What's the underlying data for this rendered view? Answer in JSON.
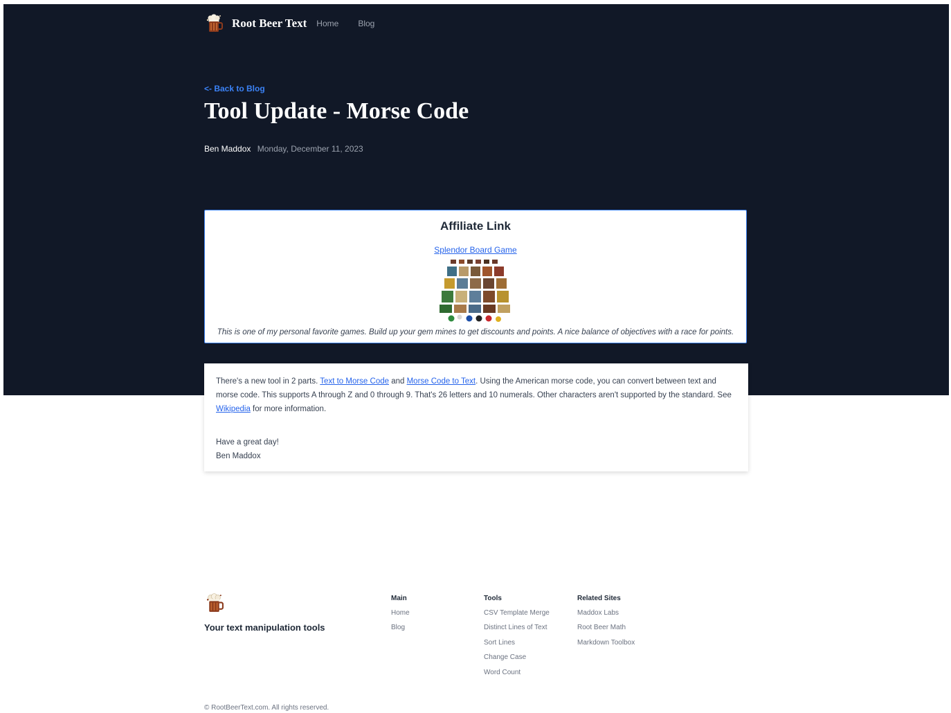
{
  "nav": {
    "brand": "Root Beer Text",
    "links": [
      "Home",
      "Blog"
    ]
  },
  "post": {
    "back_label": "<- Back to Blog",
    "title": "Tool Update - Morse Code",
    "author": "Ben Maddox",
    "date": "Monday, December 11, 2023",
    "body": {
      "t1": "There's a new tool in 2 parts. ",
      "link1": "Text to Morse Code",
      "t2": " and ",
      "link2": "Morse Code to Text",
      "t3": ". Using the American morse code, you can convert between text and morse code. This supports A through Z and 0 through 9. That's 26 letters and 10 numerals. Other characters aren't supported by the standard. See ",
      "link3": "Wikipedia",
      "t4": " for more information."
    },
    "signoff": "Have a great day!",
    "signature": "Ben Maddox"
  },
  "affiliate": {
    "heading": "Affiliate Link",
    "link": "Splendor Board Game",
    "caption": "This is one of my personal favorite games. Build up your gem mines to get discounts and points. A nice balance of objectives with a race for points."
  },
  "footer": {
    "tagline": "Your text manipulation tools",
    "columns": {
      "main": {
        "title": "Main",
        "links": [
          "Home",
          "Blog"
        ]
      },
      "tools": {
        "title": "Tools",
        "links": [
          "CSV Template Merge",
          "Distinct Lines of Text",
          "Sort Lines",
          "Change Case",
          "Word Count"
        ]
      },
      "related": {
        "title": "Related Sites",
        "links": [
          "Maddox Labs",
          "Root Beer Math",
          "Markdown Toolbox"
        ]
      }
    },
    "copyright": "© RootBeerText.com. All rights reserved."
  },
  "colors": {
    "hero_bg": "#111827",
    "link_blue": "#2563eb",
    "accent_blue": "#3b82f6"
  }
}
